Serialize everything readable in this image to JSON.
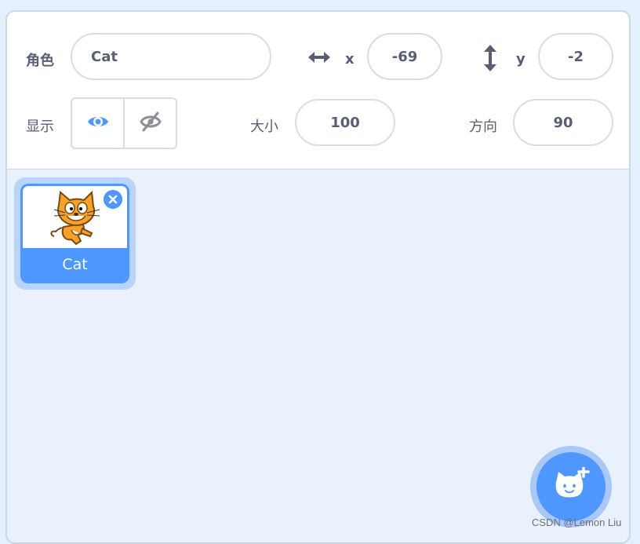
{
  "sprite_info": {
    "sprite_label": "角色",
    "sprite_name": "Cat",
    "x_label": "x",
    "x_value": "-69",
    "y_label": "y",
    "y_value": "-2",
    "show_label": "显示",
    "size_label": "大小",
    "size_value": "100",
    "direction_label": "方向",
    "direction_value": "90",
    "visible": true
  },
  "sprites": [
    {
      "name": "Cat",
      "selected": true
    }
  ],
  "icons": {
    "x_arrow": "horizontal-double-arrow-icon",
    "y_arrow": "vertical-double-arrow-icon",
    "show": "eye-icon",
    "hide": "eye-slash-icon",
    "delete": "close-icon",
    "add_sprite": "cat-plus-icon"
  },
  "colors": {
    "accent": "#4d97ff",
    "accent_light": "#b9d4fb",
    "text": "#575e75",
    "panel_bg": "#e9f1fc"
  },
  "watermark": "CSDN @Lemon Liu"
}
